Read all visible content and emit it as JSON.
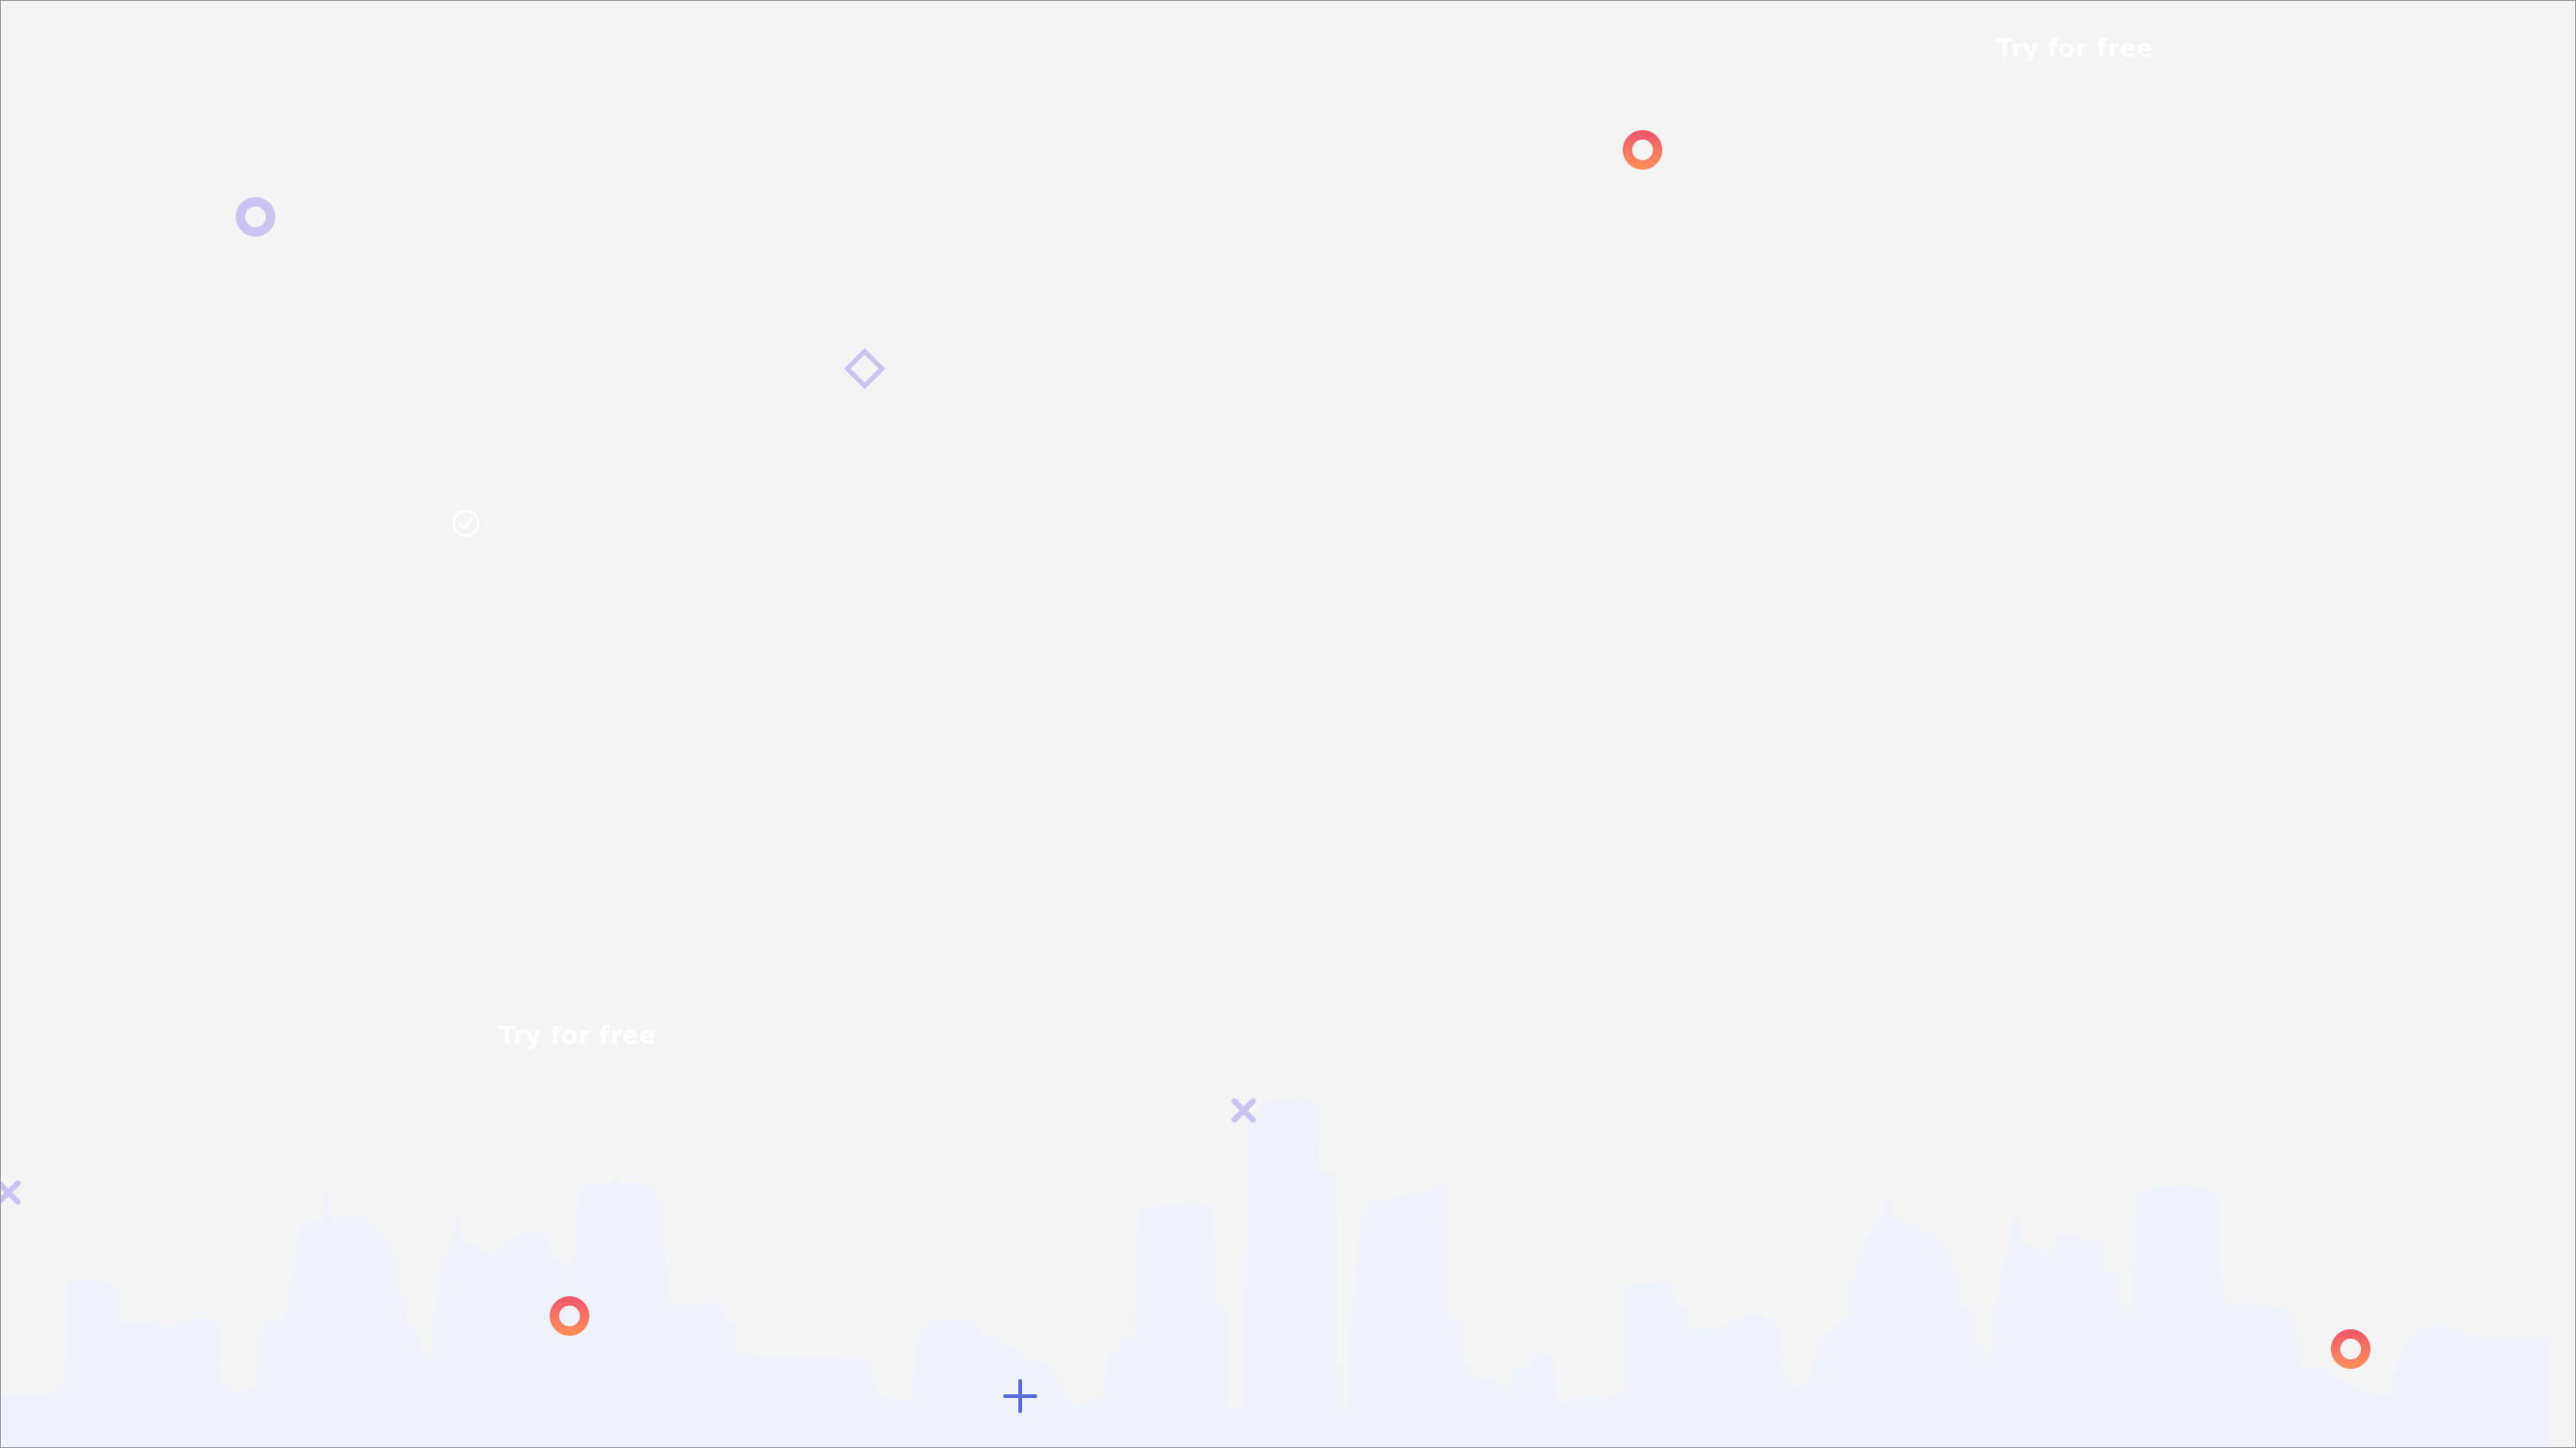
{
  "cta": {
    "top_label": "Try for free",
    "bottom_label": "Try for free"
  },
  "icons": {
    "ring_red": "ring-red-icon",
    "ring_purple": "ring-purple-icon",
    "diamond": "diamond-icon",
    "check": "check-circle-icon",
    "cross": "cross-icon",
    "plus": "plus-icon"
  },
  "colors": {
    "background": "#f4f4f4",
    "skyline": "#edf2fb",
    "ring_red_start": "#f25c6a",
    "ring_red_end": "#ff8a5c",
    "purple": "#cbc3f2",
    "plus": "#5b6fd6",
    "cta_text": "#ffffff"
  }
}
